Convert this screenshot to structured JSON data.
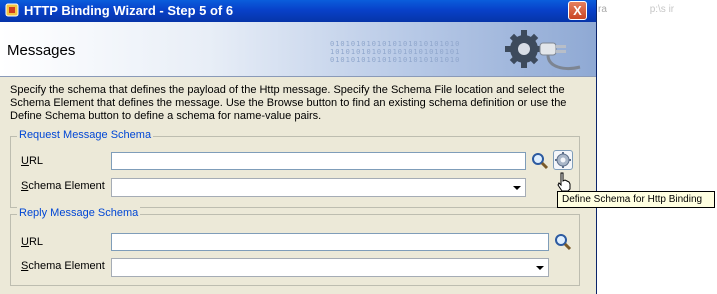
{
  "window": {
    "title": "HTTP Binding Wizard - Step 5 of 6",
    "close_label": "X"
  },
  "header": {
    "page_title": "Messages",
    "binary_lines": [
      "0101010101010101010101010",
      "1010101010101010101010101",
      "0101010101010101010101010"
    ]
  },
  "description": "Specify the schema that defines the payload of the Http message.  Specify the Schema File location and select the Schema Element that defines the message. Use the Browse button to find an existing schema definition or use the Define Schema button to define a schema for name-value pairs.",
  "request": {
    "legend": "Request Message Schema",
    "url_label": "URL",
    "url_value": "",
    "schema_label": "Schema Element",
    "schema_value": ""
  },
  "reply": {
    "legend": "Reply Message Schema",
    "url_label": "URL",
    "url_value": "",
    "schema_label": "Schema Element",
    "schema_value": ""
  },
  "tooltip": "Define Schema for Http Binding",
  "background_app": {
    "text_1": "ra",
    "text_2": "p:\\s  ir"
  },
  "colors": {
    "titlebar": "#0a5ddc",
    "legend": "#0046d5",
    "dialog_bg": "#ece9d8"
  }
}
